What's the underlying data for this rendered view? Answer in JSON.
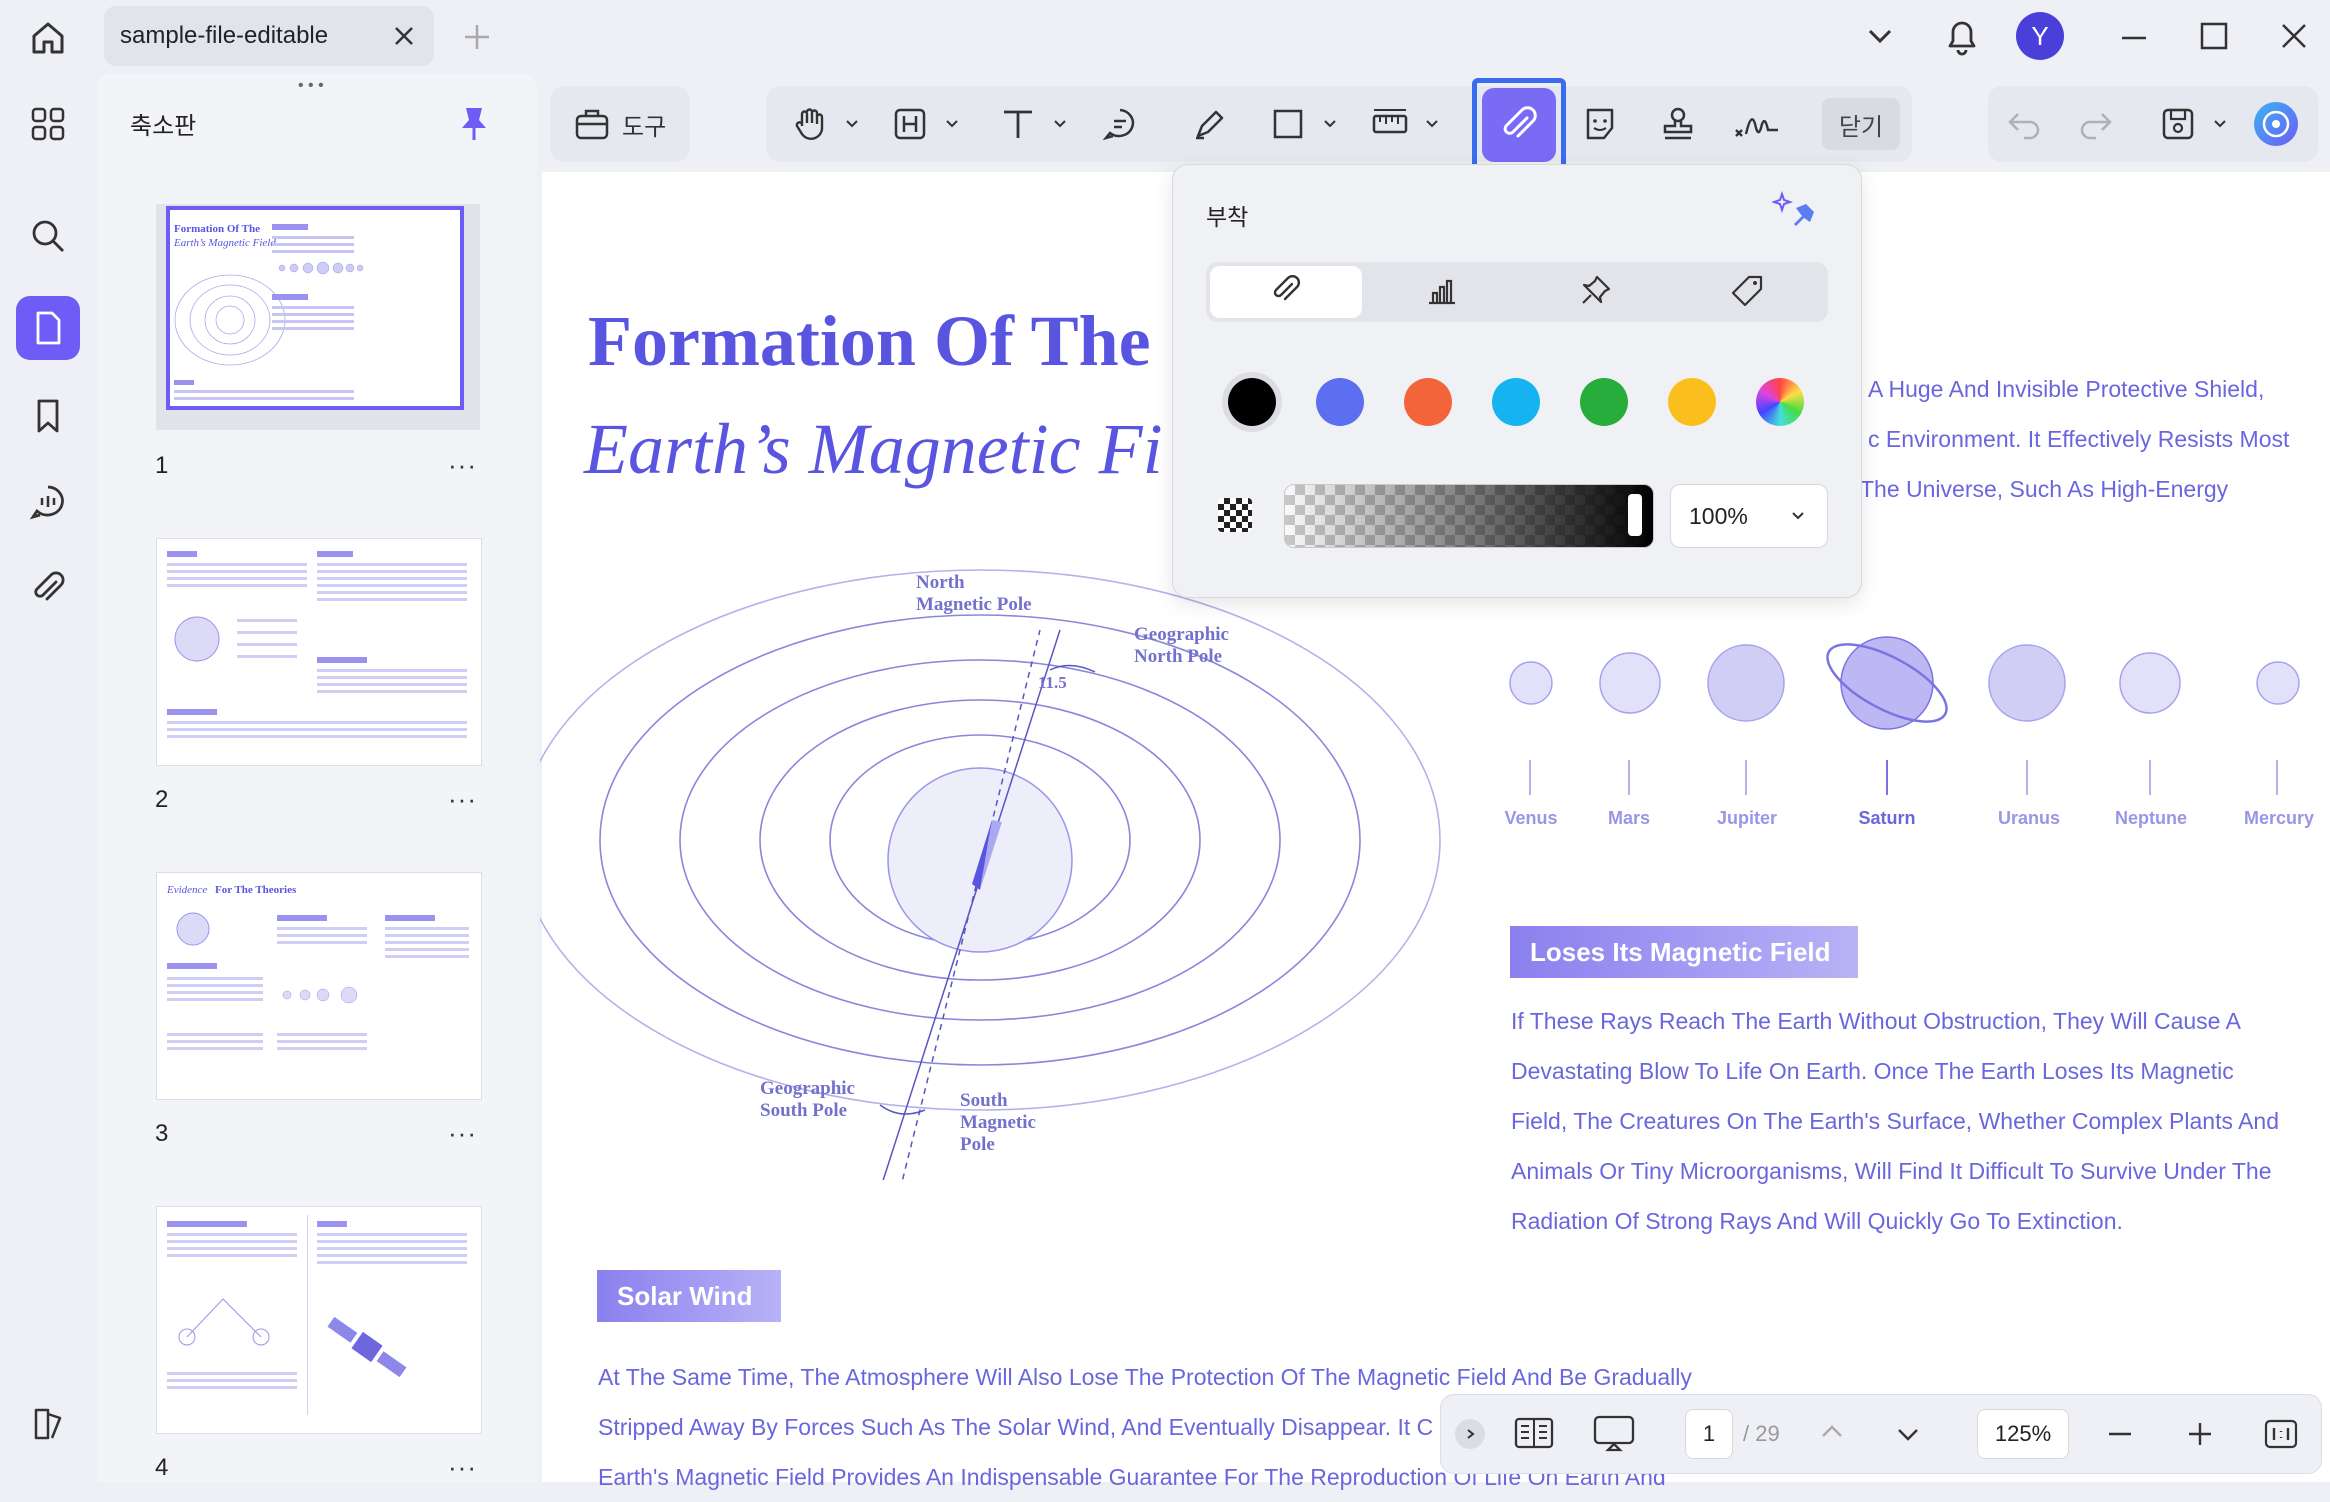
{
  "window": {
    "tab_title": "sample-file-editable",
    "avatar_letter": "Y"
  },
  "sidebar": {
    "title": "축소판",
    "pages": [
      "1",
      "2",
      "3",
      "4"
    ]
  },
  "toolbar": {
    "tools_label": "도구",
    "close_label": "닫기"
  },
  "attach_popup": {
    "title": "부착",
    "tabs": [
      "attachment-icon",
      "chart-icon",
      "pushpin-icon",
      "tag-icon"
    ],
    "colors": [
      "#000000",
      "#5b6ff0",
      "#f4643a",
      "#15b3ef",
      "#28ac3c",
      "#fbbf1d",
      "rainbow"
    ],
    "opacity_value": "100%"
  },
  "document": {
    "title_line1": "Formation Of The",
    "title_line2": "Earth’s Magnetic Fi",
    "intro_lines": [
      "A Huge And Invisible Protective Shield,",
      "c Environment. It Effectively Resists Most",
      "The Universe, Such As High-Energy"
    ],
    "diagram_labels": {
      "north_magnetic": [
        "North",
        "Magnetic Pole"
      ],
      "geo_north": [
        "Geographic",
        "North Pole"
      ],
      "angle": "11.5",
      "geo_south": [
        "Geographic",
        "South Pole"
      ],
      "south_magnetic": [
        "South",
        "Magnetic",
        "Pole"
      ]
    },
    "planets": [
      "Venus",
      "Mars",
      "Jupiter",
      "Saturn",
      "Uranus",
      "Neptune",
      "Mercury"
    ],
    "section1_heading": "Loses Its Magnetic Field",
    "section1_lines": [
      "If These Rays Reach The Earth Without Obstruction, They Will Cause A",
      "Devastating Blow To Life On Earth. Once The Earth Loses Its Magnetic",
      "Field, The Creatures On The Earth's Surface, Whether Complex Plants And",
      "Animals Or Tiny Microorganisms, Will Find It Difficult To Survive Under The",
      "Radiation Of Strong Rays And Will Quickly Go To Extinction."
    ],
    "section2_heading": "Solar Wind",
    "section2_lines": [
      "At The Same Time, The Atmosphere Will Also Lose The Protection Of The Magnetic Field And Be Gradually",
      "Stripped Away By Forces Such As The Solar Wind, And Eventually Disappear. It C",
      "Earth's Magnetic Field Provides An Indispensable Guarantee For The Reproduction Of Life On Earth And"
    ]
  },
  "bottombar": {
    "current_page": "1",
    "total_pages": "/ 29",
    "zoom": "125%"
  }
}
